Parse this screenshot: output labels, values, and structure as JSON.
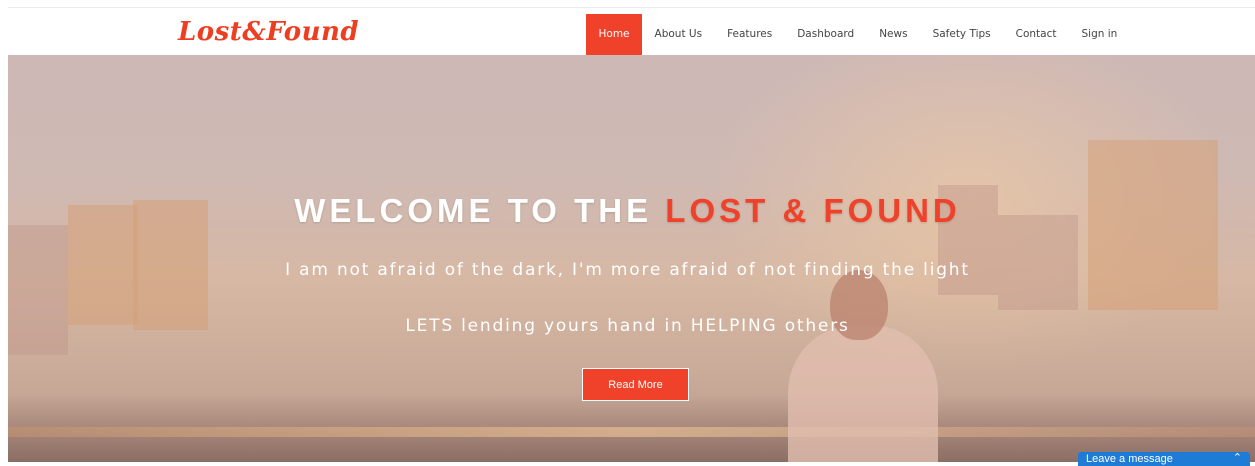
{
  "brand": {
    "logo_text": "Lost&Found"
  },
  "nav": {
    "items": [
      {
        "label": "Home",
        "active": true
      },
      {
        "label": "About Us"
      },
      {
        "label": "Features"
      },
      {
        "label": "Dashboard"
      },
      {
        "label": "News"
      },
      {
        "label": "Safety Tips"
      },
      {
        "label": "Contact"
      },
      {
        "label": "Sign in"
      }
    ]
  },
  "hero": {
    "title_prefix": "WELCOME TO THE ",
    "title_accent": "LOST & FOUND",
    "subtitle_1": "I am not afraid of the dark, I'm more afraid of not finding the light",
    "subtitle_2": "LETS lending yours hand in HELPING others",
    "cta_label": "Read More"
  },
  "chat": {
    "label": "Leave a message",
    "icon": "chevron-up-icon"
  },
  "colors": {
    "accent": "#f0412b",
    "chat": "#1e7bd6"
  }
}
